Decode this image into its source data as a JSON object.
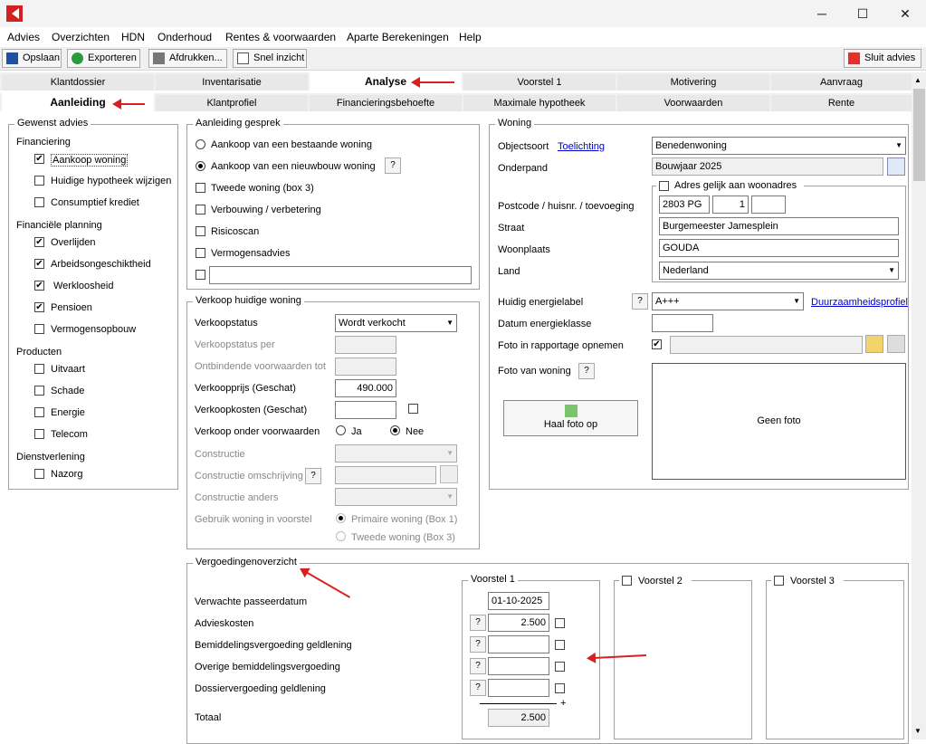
{
  "window": {
    "min": "─",
    "max": "☐",
    "close": "✕"
  },
  "menu": [
    "Advies",
    "Overzichten",
    "HDN",
    "Onderhoud",
    "Rentes & voorwaarden",
    "Aparte Berekeningen",
    "Help"
  ],
  "toolbar": {
    "save": "Opslaan",
    "export": "Exporteren",
    "print": "Afdrukken...",
    "quick": "Snel inzicht",
    "close": "Sluit advies"
  },
  "tabs1": [
    "Klantdossier",
    "Inventarisatie",
    "Analyse",
    "Voorstel 1",
    "Motivering",
    "Aanvraag"
  ],
  "tabs2": [
    "Aanleiding",
    "Klantprofiel",
    "Financieringsbehoefte",
    "Maximale hypotheek",
    "Voorwaarden",
    "Rente"
  ],
  "gewenst": {
    "title": "Gewenst advies",
    "financiering": "Financiering",
    "fin_items": [
      "Aankoop woning",
      "Huidige hypotheek wijzigen",
      "Consumptief krediet"
    ],
    "planning": "Financiële planning",
    "plan_items": [
      "Overlijden",
      "Arbeidsongeschiktheid",
      "Werkloosheid",
      "Pensioen",
      "Vermogensopbouw"
    ],
    "producten": "Producten",
    "prod_items": [
      "Uitvaart",
      "Schade",
      "Energie",
      "Telecom"
    ],
    "dienst": "Dienstverlening",
    "dienst_items": [
      "Nazorg"
    ]
  },
  "aanleiding": {
    "title": "Aanleiding gesprek",
    "r1": "Aankoop van een bestaande woning",
    "r2": "Aankoop van een nieuwbouw woning",
    "c1": "Tweede woning (box 3)",
    "c2": "Verbouwing / verbetering",
    "c3": "Risicoscan",
    "c4": "Vermogensadvies"
  },
  "verkoop": {
    "title": "Verkoop huidige woning",
    "status_lbl": "Verkoopstatus",
    "status_val": "Wordt verkocht",
    "per": "Verkoopstatus per",
    "ontb": "Ontbindende voorwaarden tot",
    "prijs_lbl": "Verkoopprijs (Geschat)",
    "prijs_val": "490.000",
    "kosten": "Verkoopkosten (Geschat)",
    "onder": "Verkoop onder voorwaarden",
    "ja": "Ja",
    "nee": "Nee",
    "constr": "Constructie",
    "constr_om": "Constructie omschrijving",
    "constr_and": "Constructie anders",
    "gebruik": "Gebruik woning in voorstel",
    "prim": "Primaire woning (Box 1)",
    "tweede": "Tweede woning (Box 3)"
  },
  "woning": {
    "title": "Woning",
    "objectsoort": "Objectsoort",
    "toelichting": "Toelichting",
    "obj_val": "Benedenwoning",
    "onderpand": "Onderpand",
    "onderpand_val": "Bouwjaar 2025",
    "adres_gelijk": "Adres gelijk aan woonadres",
    "postcode_lbl": "Postcode / huisnr. / toevoeging",
    "postcode": "2803 PG",
    "huisnr": "1",
    "straat_lbl": "Straat",
    "straat": "Burgemeester Jamesplein",
    "plaats_lbl": "Woonplaats",
    "plaats": "GOUDA",
    "land_lbl": "Land",
    "land": "Nederland",
    "energie_lbl": "Huidig energielabel",
    "energie": "A+++",
    "duurz": "Duurzaamheidsprofiel",
    "datum_lbl": "Datum energieklasse",
    "foto_rap": "Foto in rapportage opnemen",
    "foto_van": "Foto van woning",
    "haal": "Haal foto op",
    "geen": "Geen foto"
  },
  "vergoeding": {
    "title": "Vergoedingenoverzicht",
    "passeer": "Verwachte passeerdatum",
    "advies": "Advieskosten",
    "bemidd": "Bemiddelingsvergoeding geldlening",
    "overige": "Overige bemiddelingsvergoeding",
    "dossier": "Dossiervergoeding geldlening",
    "totaal": "Totaal",
    "v1": "Voorstel 1",
    "v2": "Voorstel 2",
    "v3": "Voorstel 3",
    "datum": "01-10-2025",
    "advies_val": "2.500",
    "totaal_val": "2.500",
    "plus": "+"
  },
  "q": "?",
  "check": "✔",
  "colors": {
    "accent": "#d82020"
  }
}
